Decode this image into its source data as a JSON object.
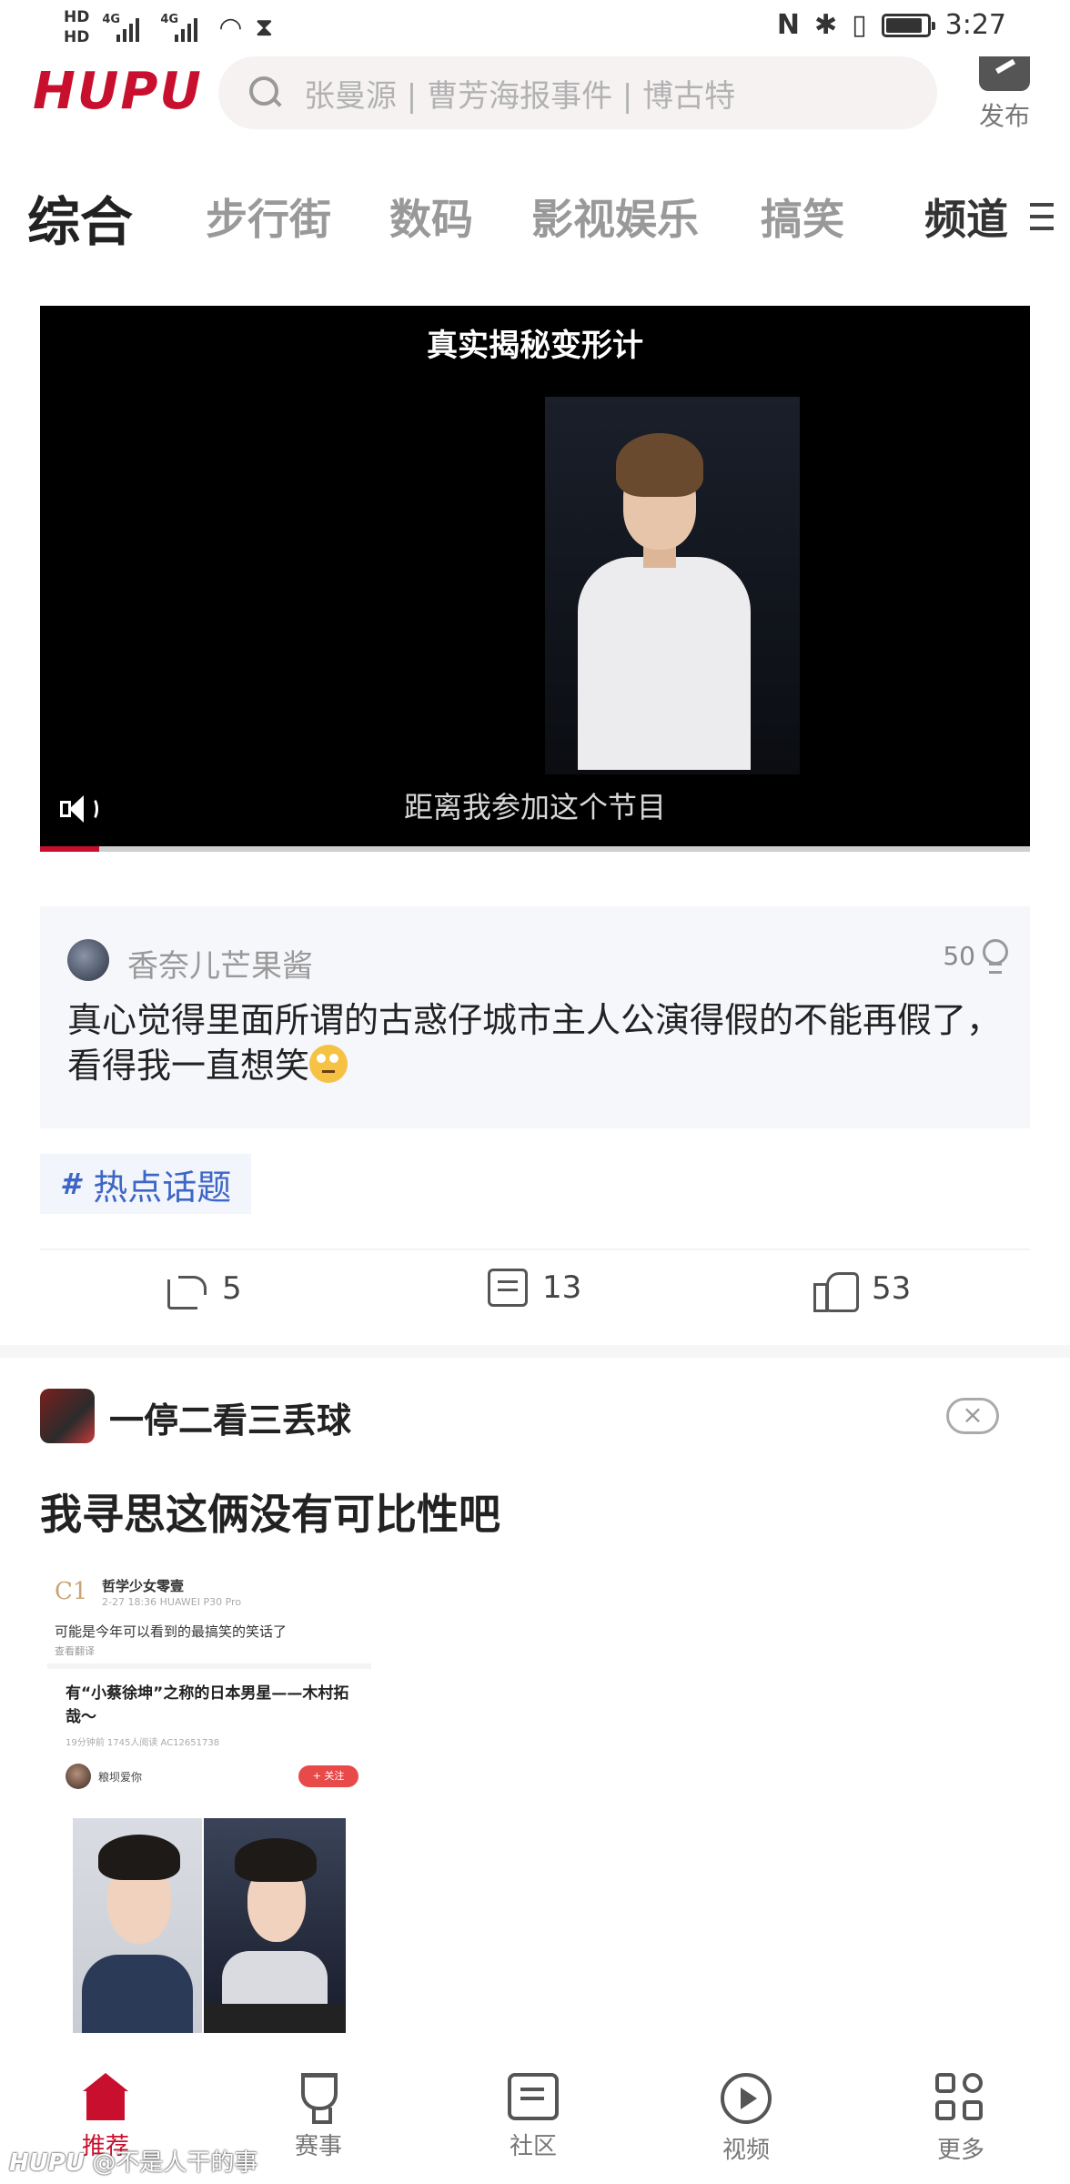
{
  "status_bar": {
    "hd1": "HD",
    "hd2": "HD",
    "net1": "4G",
    "net2": "4G",
    "time": "3:27",
    "battery_level": 0.9
  },
  "header": {
    "logo": "HUPU",
    "search_placeholder": "张曼源 | 曹芳海报事件 | 博古特",
    "publish_label": "发布"
  },
  "tabs": [
    {
      "label": "综合",
      "active": true
    },
    {
      "label": "步行街",
      "active": false
    },
    {
      "label": "数码",
      "active": false
    },
    {
      "label": "影视娱乐",
      "active": false
    },
    {
      "label": "搞笑",
      "active": false
    },
    {
      "label": "频道",
      "active": false
    }
  ],
  "video": {
    "title": "真实揭秘变形计",
    "subtitle": "距离我参加这个节目",
    "progress": 0.06
  },
  "top_comment": {
    "user": "香奈儿芒果酱",
    "likes": "50",
    "text": "真心觉得里面所谓的古惑仔城市主人公演得假的不能再假了，看得我一直想笑"
  },
  "topic": {
    "icon": "#",
    "label": "热点话题"
  },
  "actions": {
    "share_count": "5",
    "comment_count": "13",
    "like_count": "53"
  },
  "post2": {
    "user": "一停二看三丢球",
    "close_glyph": "×",
    "title": "我寻思这俩没有可比性吧",
    "screenshot": {
      "avatar_glyph": "C1",
      "name": "哲学少女零壹",
      "meta": "2-27 18:36   HUAWEI P30 Pro",
      "text": "可能是今年可以看到的最搞笑的笑话了",
      "translate": "查看翻译",
      "post_title": "有“小蔡徐坤”之称的日本男星——木村拓哉～",
      "post_meta": "19分钟前   1745人阅读   AC12651738",
      "author": "粮坝爱你",
      "follow": "+ 关注"
    }
  },
  "bottom_nav": [
    {
      "label": "推荐",
      "icon": "home-icon",
      "active": true
    },
    {
      "label": "赛事",
      "icon": "trophy-icon",
      "active": false
    },
    {
      "label": "社区",
      "icon": "community-icon",
      "active": false
    },
    {
      "label": "视频",
      "icon": "video-play-icon",
      "active": false
    },
    {
      "label": "更多",
      "icon": "more-grid-icon",
      "active": false
    }
  ],
  "watermark": {
    "logo": "HUPU",
    "text": "@不是人干的事"
  },
  "colors": {
    "brand": "#c8102e",
    "topic_blue": "#3e66c6"
  }
}
